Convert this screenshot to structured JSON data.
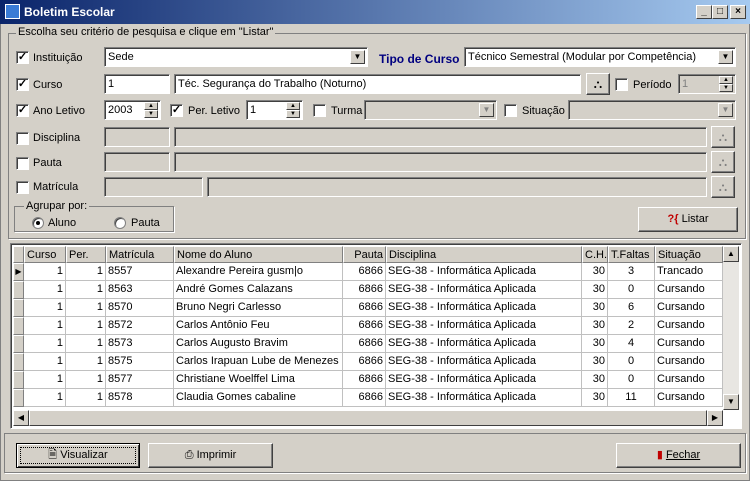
{
  "window": {
    "title": "Boletim Escolar",
    "min_icon": "minimize-icon",
    "max_icon": "maximize-icon",
    "close_icon": "close-icon"
  },
  "criteria": {
    "legend": "Escolha seu critério de pesquisa e clique em \"Listar\"",
    "instituicao": {
      "label": "Instituição",
      "checked": true,
      "value": "Sede"
    },
    "tipo_curso": {
      "label": "Tipo de Curso",
      "value": "Técnico Semestral (Modular por Competência)"
    },
    "curso": {
      "label": "Curso",
      "checked": true,
      "code": "1",
      "name": "Téc. Segurança do Trabalho (Noturno)"
    },
    "periodo": {
      "label": "Período",
      "checked": false,
      "value": "1"
    },
    "ano_letivo": {
      "label": "Ano Letivo",
      "checked": true,
      "value": "2003"
    },
    "per_letivo": {
      "label": "Per. Letivo",
      "checked": true,
      "value": "1"
    },
    "turma": {
      "label": "Turma",
      "checked": false,
      "value": ""
    },
    "situacao": {
      "label": "Situação",
      "checked": false,
      "value": ""
    },
    "disciplina": {
      "label": "Disciplina",
      "checked": false
    },
    "pauta": {
      "label": "Pauta",
      "checked": false
    },
    "matricula": {
      "label": "Matrícula",
      "checked": false
    },
    "agrupar": {
      "legend": "Agrupar por:",
      "options": [
        "Aluno",
        "Pauta"
      ],
      "selected": "Aluno"
    },
    "listar_label": "Listar"
  },
  "grid": {
    "columns": [
      "Curso",
      "Per.",
      "Matrícula",
      "Nome do Aluno",
      "Pauta",
      "Disciplina",
      "C.H.",
      "T.Faltas",
      "Situação"
    ],
    "rows": [
      [
        "1",
        "1",
        "8557",
        "Alexandre Pereira gusm|o",
        "6866",
        "SEG-38 - Informática Aplicada",
        "30",
        "3",
        "Trancado"
      ],
      [
        "1",
        "1",
        "8563",
        "André Gomes Calazans",
        "6866",
        "SEG-38 - Informática Aplicada",
        "30",
        "0",
        "Cursando"
      ],
      [
        "1",
        "1",
        "8570",
        "Bruno Negri Carlesso",
        "6866",
        "SEG-38 - Informática Aplicada",
        "30",
        "6",
        "Cursando"
      ],
      [
        "1",
        "1",
        "8572",
        "Carlos Antônio Feu",
        "6866",
        "SEG-38 - Informática Aplicada",
        "30",
        "2",
        "Cursando"
      ],
      [
        "1",
        "1",
        "8573",
        "Carlos Augusto Bravim",
        "6866",
        "SEG-38 - Informática Aplicada",
        "30",
        "4",
        "Cursando"
      ],
      [
        "1",
        "1",
        "8575",
        "Carlos Irapuan Lube de Menezes",
        "6866",
        "SEG-38 - Informática Aplicada",
        "30",
        "0",
        "Cursando"
      ],
      [
        "1",
        "1",
        "8577",
        "Christiane Woelffel Lima",
        "6866",
        "SEG-38 - Informática Aplicada",
        "30",
        "0",
        "Cursando"
      ],
      [
        "1",
        "1",
        "8578",
        "Claudia Gomes cabaline",
        "6866",
        "SEG-38 - Informática Aplicada",
        "30",
        "11",
        "Cursando"
      ]
    ]
  },
  "footer": {
    "visualizar": "Visualizar",
    "imprimir": "Imprimir",
    "fechar": "Fechar"
  },
  "colors": {
    "titlebar": "#0a246a",
    "tipo_curso_label": "#000080",
    "face": "#d4d0c8"
  }
}
